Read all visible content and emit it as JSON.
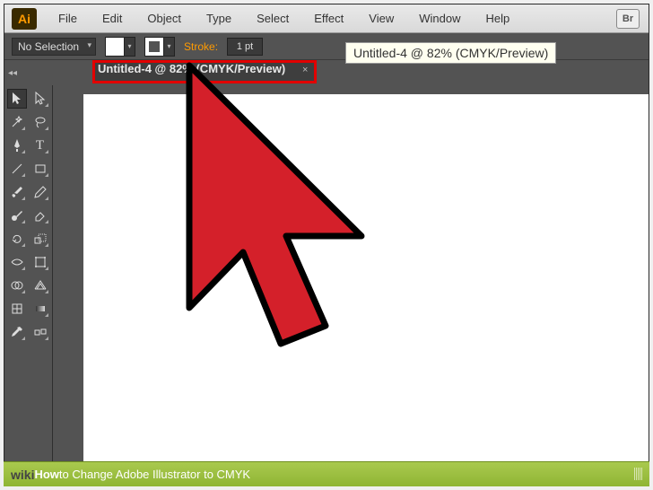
{
  "menubar": {
    "items": [
      "File",
      "Edit",
      "Object",
      "Type",
      "Select",
      "Effect",
      "View",
      "Window",
      "Help"
    ],
    "logo": "Ai",
    "bridge": "Br"
  },
  "controlbar": {
    "selection": "No Selection",
    "stroke_label": "Stroke:",
    "stroke_value": "1 pt"
  },
  "tooltip": "Untitled-4 @ 82% (CMYK/Preview)",
  "tab": {
    "label": "Untitled-4 @ 82% (CMYK/Preview)",
    "close": "×"
  },
  "tools": {
    "selection": "selection-tool",
    "direct": "direct-selection-tool",
    "wand": "magic-wand-tool",
    "lasso": "lasso-tool",
    "pen": "pen-tool",
    "type": "type-tool",
    "line": "line-tool",
    "rect": "rectangle-tool",
    "brush": "paintbrush-tool",
    "pencil": "pencil-tool",
    "blob": "blob-brush-tool",
    "eraser": "eraser-tool",
    "rotate": "rotate-tool",
    "scale": "scale-tool",
    "width": "width-tool",
    "free": "free-transform-tool",
    "shapebuilder": "shape-builder-tool",
    "perspective": "perspective-grid-tool",
    "mesh": "mesh-tool",
    "gradient": "gradient-tool",
    "eyedropper": "eyedropper-tool",
    "blend": "blend-tool"
  },
  "caption": {
    "wiki": "wiki",
    "how": "How ",
    "rest": "to Change Adobe Illustrator to CMYK"
  }
}
